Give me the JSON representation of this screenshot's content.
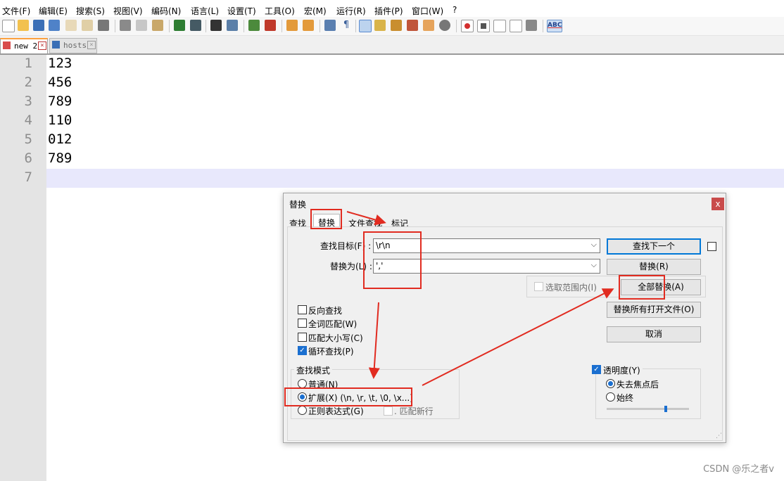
{
  "menu": [
    "文件(F)",
    "编辑(E)",
    "搜索(S)",
    "视图(V)",
    "编码(N)",
    "语言(L)",
    "设置(T)",
    "工具(O)",
    "宏(M)",
    "运行(R)",
    "插件(P)",
    "窗口(W)",
    "?"
  ],
  "toolbar": {
    "icons": [
      "new-file-icon",
      "open-file-icon",
      "save-icon",
      "save-all-icon",
      "close-icon",
      "close-all-icon",
      "print-icon",
      "cut-icon",
      "copy-icon",
      "paste-icon",
      "undo-icon",
      "redo-icon",
      "find-icon",
      "replace-icon",
      "zoom-in-icon",
      "zoom-out-icon",
      "sync-vertical-icon",
      "sync-horizontal-icon",
      "word-wrap-icon",
      "show-all-chars-icon",
      "indent-guide-icon",
      "folder-workspace-icon",
      "map-icon",
      "function-list-icon",
      "folder-icon",
      "monitor-icon",
      "record-macro-icon",
      "stop-macro-icon",
      "play-macro-icon",
      "run-macro-multiple-icon",
      "save-macro-icon",
      "spellcheck-icon"
    ],
    "spellcheck_label": "ABC"
  },
  "tabs": [
    {
      "label": "new 2",
      "active": true
    },
    {
      "label": "hosts",
      "active": false
    }
  ],
  "editor": {
    "line_numbers": [
      "1",
      "2",
      "3",
      "4",
      "5",
      "6",
      "7"
    ],
    "lines": [
      "123",
      "456",
      "789",
      "110",
      "012",
      "789",
      ""
    ]
  },
  "dialog": {
    "title": "替换",
    "close": "x",
    "tabs": [
      "查找",
      "替换",
      "文件查找",
      "标记"
    ],
    "find_label": "查找目标(F) :",
    "find_value": "\\r\\n",
    "replace_label": "替换为(L) :",
    "replace_value": "','",
    "in_selection": "选取范围内(I)",
    "buttons": {
      "find_next": "查找下一个",
      "replace": "替换(R)",
      "replace_all": "全部替换(A)",
      "replace_all_open": "替换所有打开文件(O)",
      "cancel": "取消"
    },
    "options": [
      {
        "label": "反向查找",
        "checked": false
      },
      {
        "label": "全词匹配(W)",
        "checked": false
      },
      {
        "label": "匹配大小写(C)",
        "checked": false
      },
      {
        "label": "循环查找(P)",
        "checked": true
      }
    ],
    "search_mode": {
      "title": "查找模式",
      "normal": "普通(N)",
      "extended": "扩展(X) (\\n, \\r, \\t, \\0, \\x...)",
      "regex": "正则表达式(G)",
      "dot_newline": ". 匹配新行"
    },
    "transparency": {
      "title": "透明度(Y)",
      "enabled": true,
      "on_lose_focus": "失去焦点后",
      "always": "始终",
      "level": 0.72
    }
  },
  "watermark": "CSDN @乐之者v"
}
